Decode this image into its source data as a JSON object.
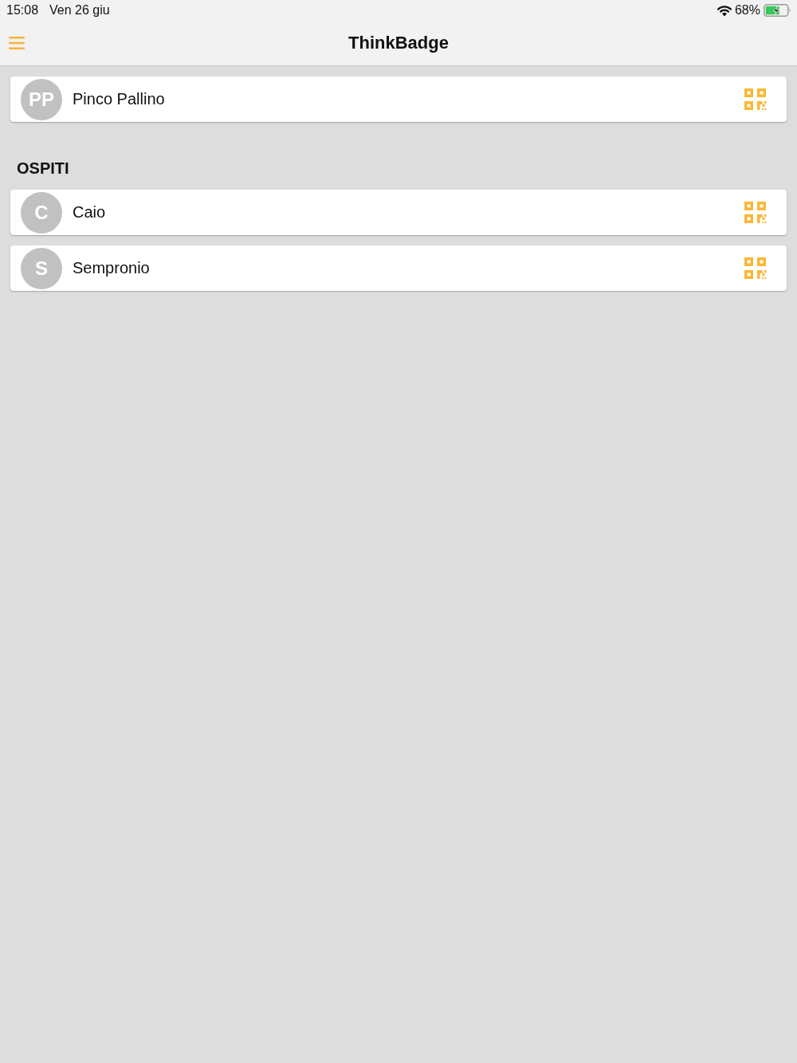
{
  "status_bar": {
    "time": "15:08",
    "date": "Ven 26 giu",
    "battery_percent": "68%"
  },
  "header": {
    "title": "ThinkBadge"
  },
  "owner": {
    "initials": "PP",
    "name": "Pinco Pallino"
  },
  "guests": {
    "heading": "OSPITI",
    "people": [
      {
        "initials": "C",
        "name": "Caio"
      },
      {
        "initials": "S",
        "name": "Sempronio"
      }
    ]
  }
}
